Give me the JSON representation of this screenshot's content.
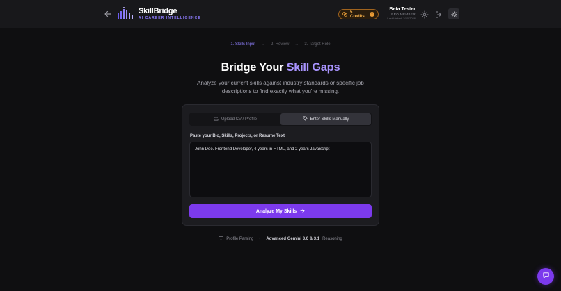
{
  "header": {
    "logo_name": "SkillBridge",
    "logo_tagline": "AI CAREER INTELLIGENCE",
    "credits_label": "5 Credits",
    "credits_plus": "+",
    "user_name": "Beta Tester",
    "user_tier": "PRO MEMBER",
    "user_last_active": "Last Visited: 3/20/2026"
  },
  "stepper": {
    "steps": [
      "1. Skills Input",
      "2. Review",
      "3. Target Role"
    ],
    "arrow": "→"
  },
  "hero": {
    "title_prefix": "Bridge Your ",
    "title_accent": "Skill Gaps",
    "subtitle": "Analyze your current skills against industry standards or specific job descriptions to find exactly what you're missing."
  },
  "card": {
    "tabs": [
      {
        "label": "Upload CV / Profile",
        "icon": "upload-icon"
      },
      {
        "label": "Enter Skills Manually",
        "icon": "tag-icon"
      }
    ],
    "active_tab": 1,
    "field_label": "Paste your Bio, Skills, Projects, or Resume Text",
    "textarea_value": "John Doe. Frontend Developer, 4 years in HTML, and 2 years JavaScript",
    "analyze_label": "Analyze My Skills"
  },
  "features": {
    "parsing_label": "Profile Parsing",
    "separator": "•",
    "model_label": "Advanced Gemini 3.0 & 3.1",
    "model_suffix": "Reasoning"
  },
  "colors": {
    "accent": "#7c3aed",
    "accent_text": "#a994ff",
    "credits": "#f5b04a",
    "background": "#0f0f11"
  }
}
